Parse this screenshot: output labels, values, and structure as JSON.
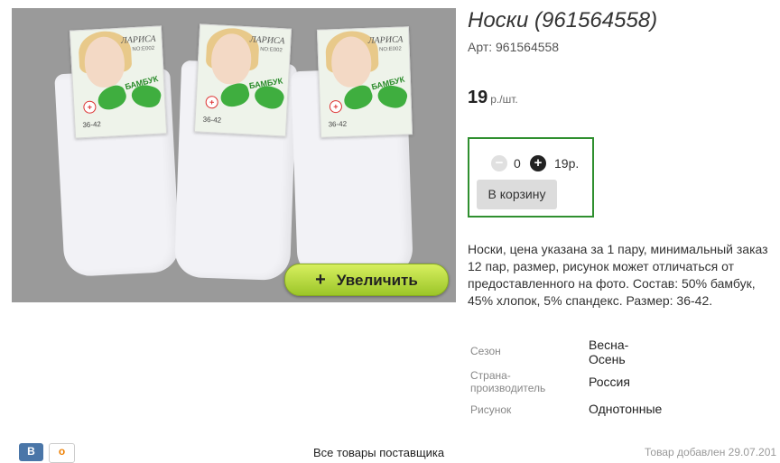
{
  "product": {
    "title": "Носки (961564558)",
    "sku": "Арт: 961564558",
    "price": "19",
    "price_unit": "р./шт.",
    "description": "Носки, цена указана за 1 пару, минимальный заказ 12 пар, размер, рисунок может отличаться от предоставленного на фото. Состав: 50% бамбук, 45% хлопок, 5% спандекс. Размер: 36-42."
  },
  "image": {
    "zoom_label": "Увеличить",
    "zoom_plus": "+",
    "package_brand": "ЛАРИСА",
    "package_model": "NO:E002",
    "package_bamboo": "БАМБУК",
    "package_size": "36-42"
  },
  "cart": {
    "minus": "−",
    "plus": "+",
    "quantity": "0",
    "total": "19р.",
    "button_label": "В корзину"
  },
  "properties": [
    {
      "label": "Сезон",
      "value": "Весна-Осень"
    },
    {
      "label": "Страна-производитель",
      "value": "Россия"
    },
    {
      "label": "Рисунок",
      "value": "Однотонные"
    }
  ],
  "footer": {
    "vk_label": "В",
    "ok_label": "о",
    "all_supplier_goods": "Все товары поставщика",
    "added_date": "Товар добавлен 29.07.201"
  },
  "colors": {
    "buybox_border": "#2f8f2f",
    "zoom_button": "#b3d940",
    "vk": "#4a76a8",
    "ok": "#ee8208"
  }
}
